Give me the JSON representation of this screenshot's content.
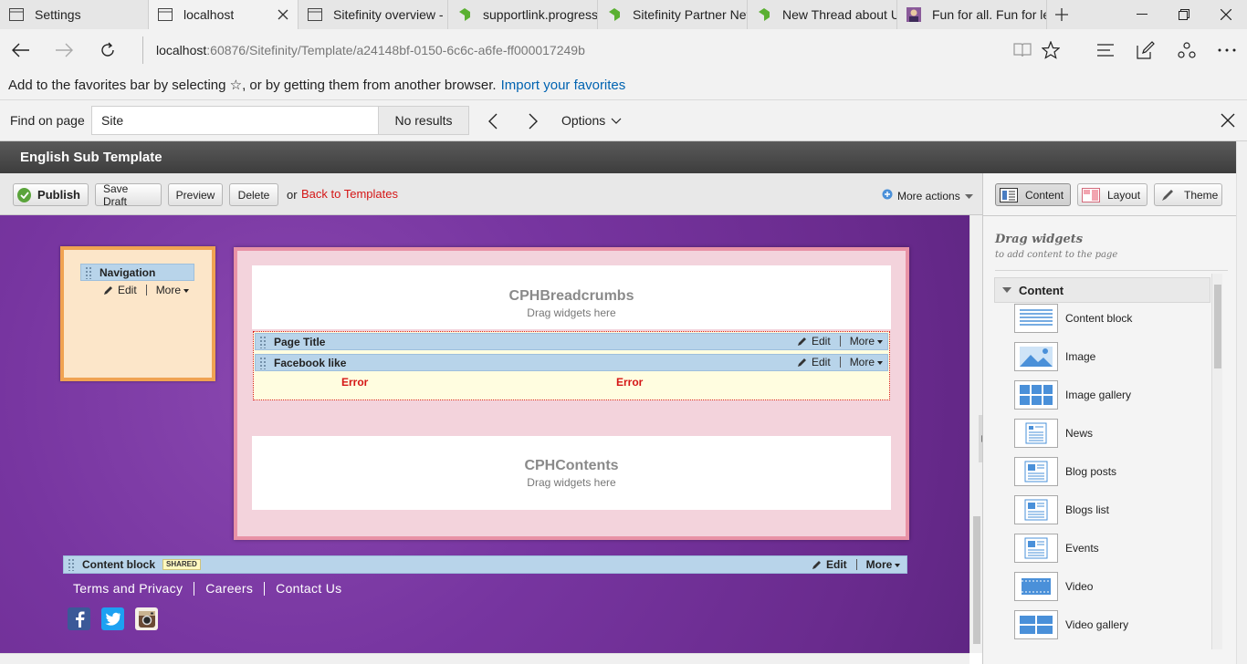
{
  "browser": {
    "tabs": [
      {
        "label": "Settings",
        "icon": "page-icon"
      },
      {
        "label": "localhost",
        "icon": "page-icon"
      },
      {
        "label": "Sitefinity overview - S",
        "icon": "page-icon"
      },
      {
        "label": "supportlink.progress.",
        "icon": "progress-logo-icon"
      },
      {
        "label": "Sitefinity Partner Netv",
        "icon": "progress-logo-icon"
      },
      {
        "label": "New Thread about UI",
        "icon": "progress-logo-icon"
      },
      {
        "label": "Fun for all. Fun for les",
        "icon": "avatar-icon"
      }
    ],
    "address": {
      "host": "localhost",
      "rest": ":60876/Sitefinity/Template/a24148bf-0150-6c6c-a6fe-ff000017249b"
    },
    "favorites_bar": {
      "text": "Add to the favorites bar by selecting ☆, or by getting them from another browser.",
      "link": "Import your favorites"
    },
    "find": {
      "label": "Find on page",
      "query": "Site",
      "results": "No results",
      "options": "Options"
    }
  },
  "sitefinity": {
    "template_title": "English Sub Template",
    "toolbar": {
      "publish": "Publish",
      "save_draft": "Save Draft",
      "preview": "Preview",
      "delete": "Delete",
      "or": "or",
      "back": "Back to Templates",
      "more_actions": "More actions"
    },
    "canvas": {
      "nav_widget": {
        "title": "Navigation",
        "edit": "Edit",
        "more": "More"
      },
      "breadcrumbs": {
        "title": "CPHBreadcrumbs",
        "hint": "Drag widgets here"
      },
      "page_title_widget": {
        "title": "Page Title",
        "edit": "Edit",
        "more": "More"
      },
      "facebook_widget": {
        "title": "Facebook like",
        "edit": "Edit",
        "more": "More"
      },
      "errors": [
        "Error",
        "Error"
      ],
      "contents": {
        "title": "CPHContents",
        "hint": "Drag widgets here"
      },
      "content_block": {
        "title": "Content block",
        "badge": "SHARED",
        "edit": "Edit",
        "more": "More"
      },
      "footer_links": [
        "Terms and Privacy",
        "Careers",
        "Contact Us"
      ],
      "social": [
        "facebook-icon",
        "twitter-icon",
        "instagram-icon"
      ]
    },
    "right_panel": {
      "tabs": [
        "Content",
        "Layout",
        "Theme"
      ],
      "drag_title": "Drag widgets",
      "drag_subtitle": "to add content to the page",
      "group": "Content",
      "widgets": [
        "Content block",
        "Image",
        "Image gallery",
        "News",
        "Blog posts",
        "Blogs list",
        "Events",
        "Video",
        "Video gallery"
      ]
    },
    "colors": {
      "canvas": "#7735a0",
      "nav_frame": "#f0a352",
      "main_frame": "#e892a6",
      "widget_bar": "#b8d4ea",
      "error": "#d51616",
      "link": "#0063b1"
    }
  }
}
